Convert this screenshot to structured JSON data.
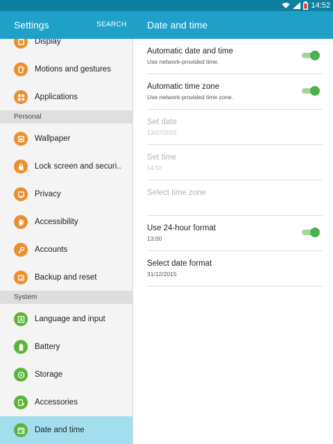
{
  "status_bar": {
    "time": "14:52",
    "icons": [
      "wifi-icon",
      "signal-icon",
      "battery-low-icon"
    ]
  },
  "app_bar": {
    "settings_title": "Settings",
    "search_label": "SEARCH",
    "panel_title": "Date and time"
  },
  "sidebar": {
    "items": [
      {
        "label": "Display",
        "icon": "display-icon"
      },
      {
        "label": "Motions and gestures",
        "icon": "motions-icon"
      },
      {
        "label": "Applications",
        "icon": "applications-icon"
      },
      {
        "label": "Wallpaper",
        "icon": "wallpaper-icon"
      },
      {
        "label": "Lock screen and securi..",
        "icon": "lock-icon"
      },
      {
        "label": "Privacy",
        "icon": "privacy-icon"
      },
      {
        "label": "Accessibility",
        "icon": "accessibility-hand-icon"
      },
      {
        "label": "Accounts",
        "icon": "key-icon"
      },
      {
        "label": "Backup and reset",
        "icon": "backup-icon"
      },
      {
        "label": "Language and input",
        "icon": "language-icon"
      },
      {
        "label": "Battery",
        "icon": "battery-icon"
      },
      {
        "label": "Storage",
        "icon": "storage-icon"
      },
      {
        "label": "Accessories",
        "icon": "accessories-icon"
      },
      {
        "label": "Date and time",
        "icon": "calendar-icon"
      }
    ],
    "headers": [
      "Personal",
      "System"
    ]
  },
  "settings": [
    {
      "title": "Automatic date and time",
      "subtitle": "Use network-provided time.",
      "toggle": true,
      "enabled": true
    },
    {
      "title": "Automatic time zone",
      "subtitle": "Use network-provided time zone.",
      "toggle": true,
      "enabled": true
    },
    {
      "title": "Set date",
      "subtitle": "13/07/2015",
      "toggle": false,
      "enabled": false
    },
    {
      "title": "Set time",
      "subtitle": "14:52",
      "toggle": false,
      "enabled": false
    },
    {
      "title": "Select time zone",
      "subtitle": "",
      "toggle": false,
      "enabled": false
    },
    {
      "title": "Use 24-hour format",
      "subtitle": "13:00",
      "toggle": true,
      "enabled": true
    },
    {
      "title": "Select date format",
      "subtitle": "31/12/2015",
      "toggle": false,
      "enabled": true
    }
  ],
  "colors": {
    "status_bar": "#0e7f9e",
    "app_bar": "#1ea0c8",
    "orange_icon": "#ec8f2c",
    "green_icon": "#5ab538",
    "selected_item": "#a3deef",
    "toggle_on": "#4caf50"
  }
}
